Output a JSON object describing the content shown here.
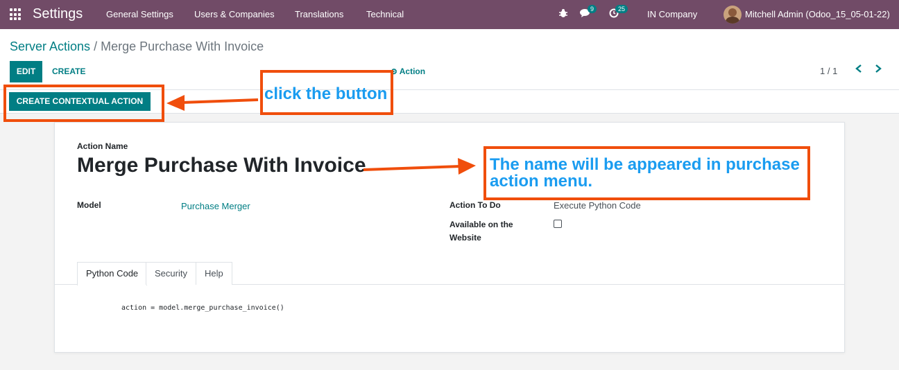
{
  "navbar": {
    "brand": "Settings",
    "menu": [
      "General Settings",
      "Users & Companies",
      "Translations",
      "Technical"
    ],
    "messages_count": "9",
    "activities_count": "25",
    "company": "IN Company",
    "user": "Mitchell Admin (Odoo_15_05-01-22)"
  },
  "breadcrumb": {
    "parent": "Server Actions",
    "separator": " / ",
    "current": "Merge Purchase With Invoice"
  },
  "control": {
    "edit_label": "EDIT",
    "create_label": "CREATE",
    "action_label": "Action",
    "pager": "1 / 1"
  },
  "statusbar": {
    "contextual_button": "CREATE CONTEXTUAL ACTION"
  },
  "form": {
    "action_name_label": "Action Name",
    "action_name": "Merge Purchase With Invoice",
    "model_label": "Model",
    "model_value": "Purchase Merger",
    "action_to_do_label": "Action To Do",
    "action_to_do_value": "Execute Python Code",
    "website_label_line1": "Available on the",
    "website_label_line2": "Website",
    "website_checked": false,
    "tabs": [
      "Python Code",
      "Security",
      "Help"
    ],
    "active_tab": "Python Code",
    "code": "action = model.merge_purchase_invoice()"
  },
  "annotations": {
    "button_hint": "click the button",
    "name_hint_line1": "The name will be appeared in purchase",
    "name_hint_line2": "action menu.",
    "color_box": "#f04e0c",
    "color_text": "#1a9cf0"
  },
  "colors": {
    "navbar": "#714B67",
    "primary": "#017e84"
  }
}
